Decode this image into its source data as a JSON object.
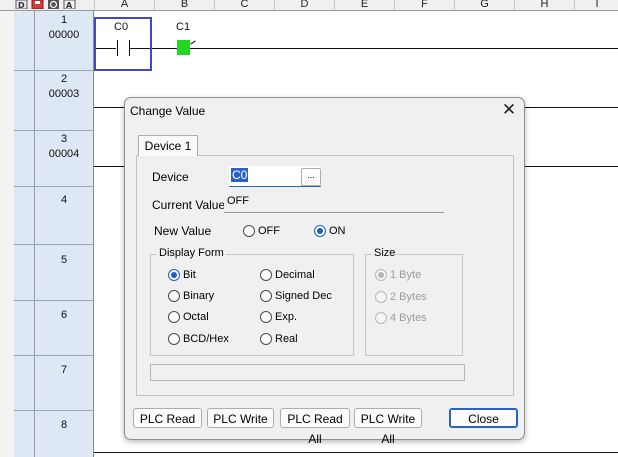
{
  "toolbar": {
    "icons": [
      "D",
      "save-icon",
      "O",
      "A"
    ]
  },
  "columns": [
    "A",
    "B",
    "C",
    "D",
    "E",
    "F",
    "G",
    "H",
    "I"
  ],
  "rows": [
    {
      "step": "1",
      "addr": "00000"
    },
    {
      "step": "2",
      "addr": "00003"
    },
    {
      "step": "3",
      "addr": "00004"
    },
    {
      "step": "4",
      "addr": ""
    },
    {
      "step": "5",
      "addr": ""
    },
    {
      "step": "6",
      "addr": ""
    },
    {
      "step": "7",
      "addr": ""
    },
    {
      "step": "8",
      "addr": ""
    }
  ],
  "ladder": {
    "contact_label": "C0",
    "coil_label": "C1",
    "coil_color": "#22d622"
  },
  "dialog": {
    "title": "Change Value",
    "close_glyph": "✕",
    "tab_label": "Device 1",
    "device_label": "Device",
    "device_value": "C0",
    "browse_label": "...",
    "current_value_label": "Current Value",
    "current_value": "OFF",
    "new_value_label": "New Value",
    "new_value_options": [
      "OFF",
      "ON"
    ],
    "new_value_selected": "ON",
    "display_form_title": "Display Form",
    "display_form_options": [
      "Bit",
      "Decimal",
      "Binary",
      "Signed Dec",
      "Octal",
      "Exp.",
      "BCD/Hex",
      "Real"
    ],
    "display_form_selected": "Bit",
    "size_title": "Size",
    "size_options": [
      "1 Byte",
      "2 Bytes",
      "4 Bytes"
    ],
    "size_selected": "1 Byte",
    "size_enabled": false,
    "status_text": "",
    "buttons": {
      "plc_read": "PLC Read",
      "plc_write": "PLC Write",
      "plc_read_all": "PLC Read All",
      "plc_write_all": "PLC Write All",
      "close": "Close"
    }
  },
  "colors": {
    "selection": "#3f49c8",
    "accent": "#2b63c4",
    "row_header_bg": "#dde8f4"
  }
}
